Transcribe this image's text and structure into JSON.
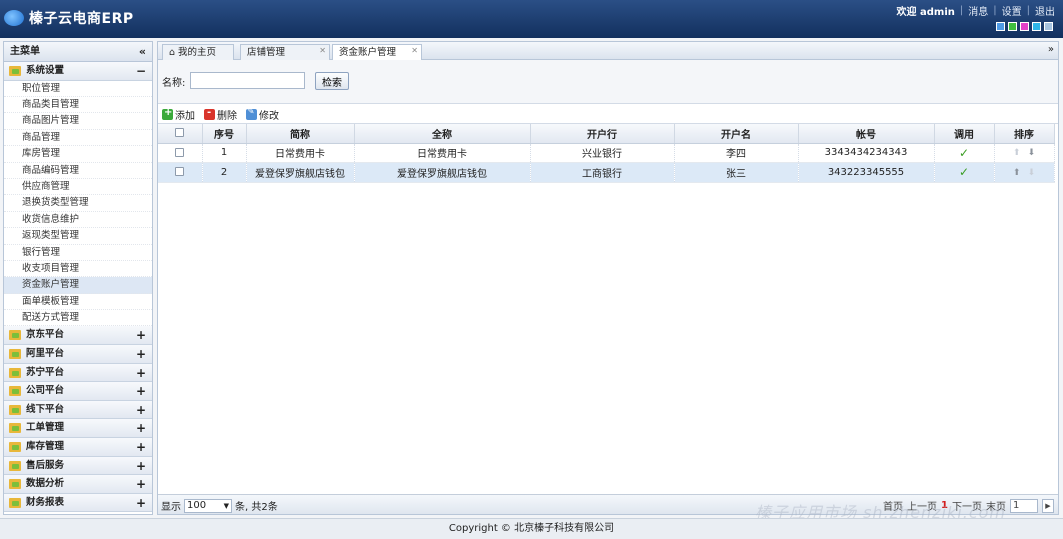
{
  "header": {
    "app_title": "榛子云电商ERP",
    "welcome": "欢迎 admin",
    "links": [
      "消息",
      "设置",
      "退出"
    ],
    "skin_colors": [
      "#4f9be6",
      "#3fbf3f",
      "#e23fc9",
      "#2fb6e8",
      "#a6c3e0"
    ]
  },
  "sidebar": {
    "title": "主菜单",
    "collapse_icon": "«",
    "groups": [
      {
        "label": "系统设置",
        "toggle": "−",
        "items": [
          "职位管理",
          "商品类目管理",
          "商品图片管理",
          "商品管理",
          "库房管理",
          "商品编码管理",
          "供应商管理",
          "退换货类型管理",
          "收货信息维护",
          "返现类型管理",
          "银行管理",
          "收支项目管理",
          "资金账户管理",
          "面单模板管理",
          "配送方式管理"
        ],
        "active_item": "资金账户管理"
      },
      {
        "label": "京东平台",
        "toggle": "+"
      },
      {
        "label": "阿里平台",
        "toggle": "+"
      },
      {
        "label": "苏宁平台",
        "toggle": "+"
      },
      {
        "label": "公司平台",
        "toggle": "+"
      },
      {
        "label": "线下平台",
        "toggle": "+"
      },
      {
        "label": "工单管理",
        "toggle": "+"
      },
      {
        "label": "库存管理",
        "toggle": "+"
      },
      {
        "label": "售后服务",
        "toggle": "+"
      },
      {
        "label": "数据分析",
        "toggle": "+"
      },
      {
        "label": "财务报表",
        "toggle": "+"
      }
    ]
  },
  "tabs": [
    {
      "label": "⌂ 我的主页",
      "closable": false
    },
    {
      "label": "店铺管理",
      "closable": true
    },
    {
      "label": "资金账户管理",
      "closable": true,
      "active": true
    }
  ],
  "tab_scroll_icon": "»",
  "search": {
    "label": "名称:",
    "value": "",
    "button": "检索"
  },
  "toolbar": {
    "add": "添加",
    "delete": "删除",
    "edit": "修改"
  },
  "table": {
    "columns": [
      "序号",
      "简称",
      "全称",
      "开户行",
      "开户名",
      "帐号",
      "调用",
      "排序"
    ],
    "rows": [
      {
        "no": "1",
        "short_name": "日常费用卡",
        "full_name": "日常费用卡",
        "bank": "兴业银行",
        "holder": "李四",
        "account": "3343434234343",
        "enabled": "✓",
        "up": "⬆",
        "down": "⬇",
        "selected": false
      },
      {
        "no": "2",
        "short_name": "爱登保罗旗舰店钱包",
        "full_name": "爱登保罗旗舰店钱包",
        "bank": "工商银行",
        "holder": "张三",
        "account": "343223345555",
        "enabled": "✓",
        "up": "⬆",
        "down": "⬇",
        "selected": true
      }
    ]
  },
  "pager": {
    "show_label": "显示",
    "page_size": "100",
    "summary": "条, 共2条",
    "first": "首页",
    "prev": "上一页",
    "current": "1",
    "next": "下一页",
    "last": "末页",
    "jump_value": "1",
    "go_icon": "▶"
  },
  "watermark": "榛子应用市场 sh.zhenzikj.com",
  "footer": {
    "copyright": "Copyright © 北京榛子科技有限公司"
  }
}
